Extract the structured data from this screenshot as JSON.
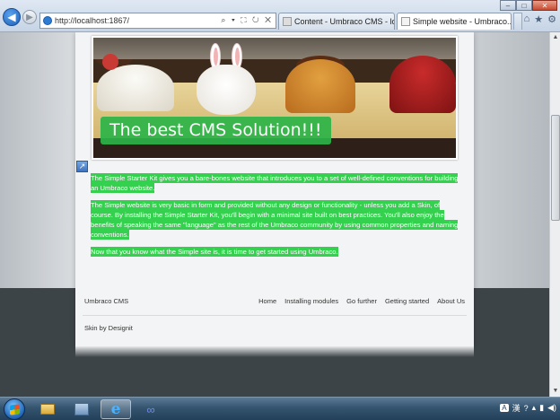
{
  "browser": {
    "address": "http://localhost:1867/",
    "address_tools": "⌕ ▾ ⛶ ↻ ✕",
    "back_icon": "back-arrow-icon",
    "forward_icon": "forward-arrow-icon",
    "tabs": [
      {
        "label": "Content - Umbraco CMS - lo...",
        "active": false
      },
      {
        "label": "Simple website - Umbraco...",
        "active": true
      }
    ],
    "window_controls": {
      "minimize": "–",
      "maximize": "□",
      "close": "✕"
    },
    "command_icons": [
      "⌂",
      "★",
      "⚙"
    ]
  },
  "banner": {
    "caption": "The best CMS Solution!!!"
  },
  "content": {
    "paragraphs": [
      "The Simple Starter Kit gives you a bare-bones website that introduces you to a set of well-defined conventions for building an Umbraco website.",
      "The Simple website is very basic in form and provided without any design or functionality - unless you add a Skin, of course. By installing the Simple Starter Kit, you'll begin with a minimal site built on best practices. You'll also enjoy the benefits of speaking the same \"language\" as the rest of the Umbraco community by using common properties and naming conventions.",
      "Now that you know what the Simple site is, it is time to get started using Umbraco."
    ],
    "highlight_color": "#33d14d"
  },
  "footer": {
    "brand": "Umbraco CMS",
    "nav": [
      "Home",
      "Installing modules",
      "Go further",
      "Getting started",
      "About Us"
    ],
    "skin_credit": "Skin by Designit"
  },
  "taskbar": {
    "tray": {
      "lang": "A",
      "ime": "漢"
    }
  }
}
